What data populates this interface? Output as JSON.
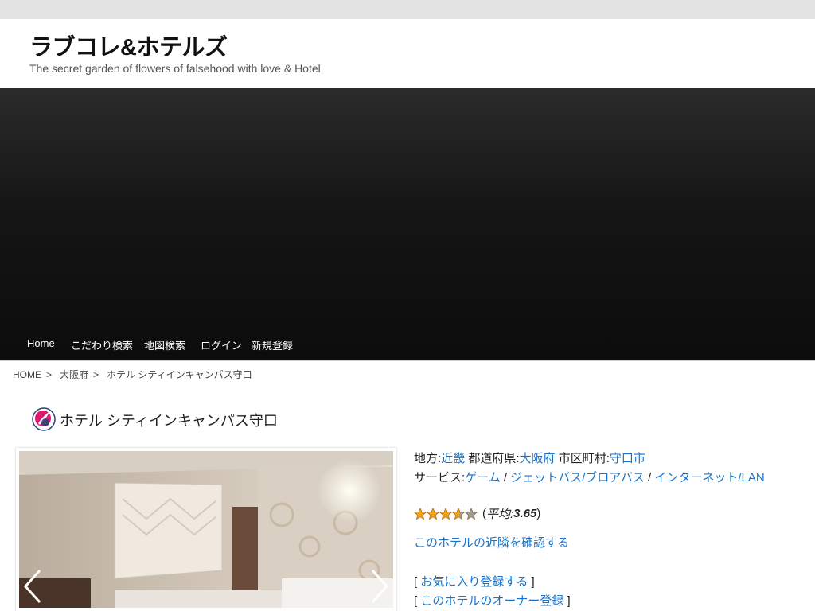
{
  "site": {
    "title": "ラブコレ&ホテルズ",
    "description": "The secret garden of flowers of falsehood with love & Hotel"
  },
  "nav": {
    "items": [
      "Home",
      "こだわり検索",
      "地図検索",
      "ログイン",
      "新規登録"
    ]
  },
  "breadcrumb": {
    "home": "HOME",
    "separator": ">",
    "prefecture": "大阪府",
    "current": "ホテル シティインキャンパス守口"
  },
  "hotel": {
    "name": "ホテル シティインキャンパス守口",
    "region_label": "地方:",
    "region": "近畿",
    "prefecture_label": "都道府県:",
    "prefecture": "大阪府",
    "city_label": "市区町村:",
    "city": "守口市",
    "services_label": "サービス:",
    "services": [
      "ゲーム",
      "ジェットバス/ブロアバス",
      "インターネット/LAN"
    ],
    "service_sep": "/",
    "rating": 3.65,
    "rating_max": 5,
    "rating_prefix": "(",
    "rating_avg_label": "平均: ",
    "rating_value_text": "3.65",
    "rating_suffix": ")",
    "neighbor_link": "このホテルの近隣を確認する",
    "favorite_link": "お気に入り登録する",
    "owner_link": "このホテルのオーナー登録",
    "bracket_open": "[",
    "bracket_close": "]"
  },
  "colors": {
    "link": "#1a73c8",
    "hero_dark": "#0c0c0c",
    "topbar": "#e3e3e3",
    "star_gold": "#f2a11c"
  },
  "icons": {
    "hotel_logo": "brand-swirl-icon",
    "prev": "chevron-left-icon",
    "next": "chevron-right-icon",
    "star": "star-icon"
  }
}
